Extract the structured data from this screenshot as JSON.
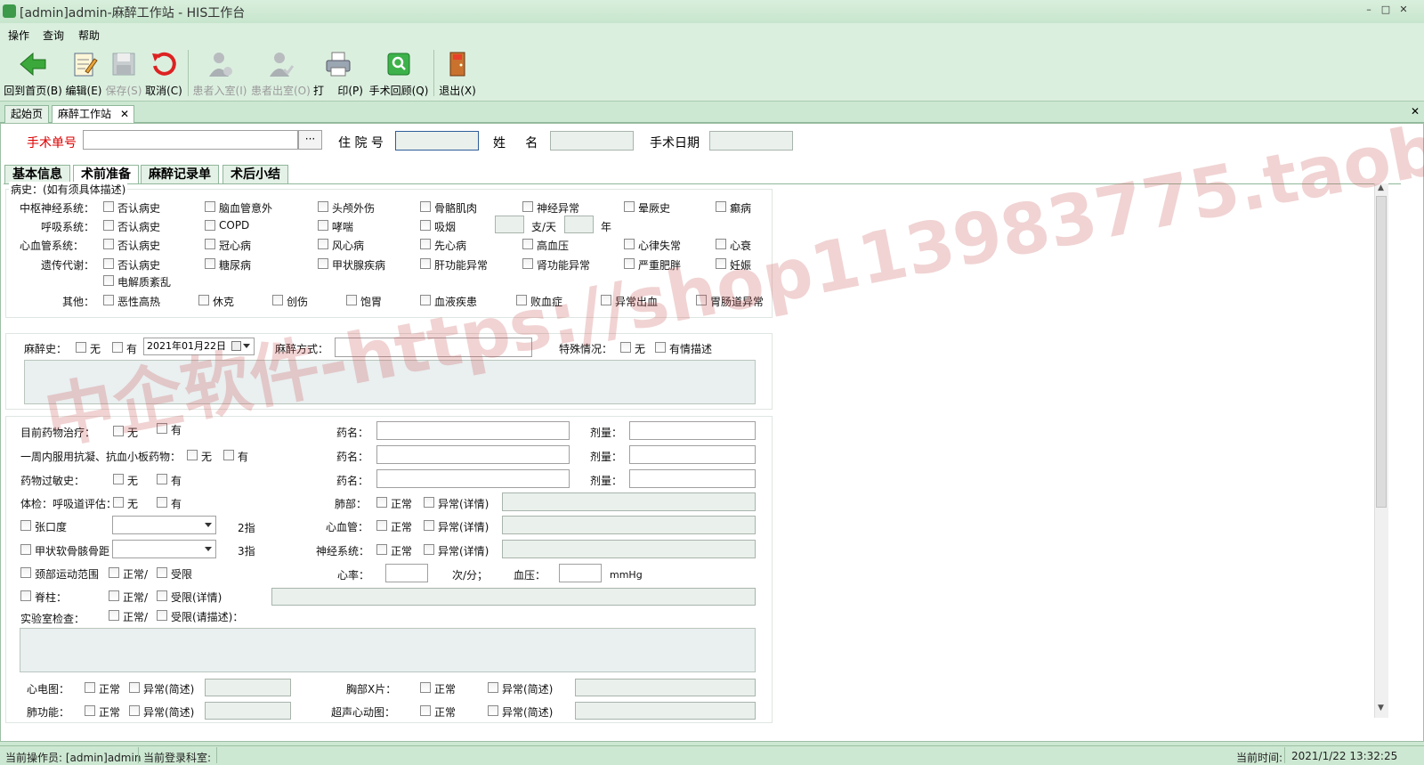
{
  "window": {
    "title": "[admin]admin-麻醉工作站 - HIS工作台",
    "min": "–",
    "max": "□",
    "close": "✕"
  },
  "menu": [
    "操作",
    "查询",
    "帮助"
  ],
  "toolbar": [
    {
      "label": "回到首页(B)",
      "icon": "home-back-icon",
      "enabled": true
    },
    {
      "label": "编辑(E)",
      "icon": "edit-icon",
      "enabled": true
    },
    {
      "label": "保存(S)",
      "icon": "save-icon",
      "enabled": false
    },
    {
      "label": "取消(C)",
      "icon": "cancel-icon",
      "enabled": true
    },
    {
      "label": "患者入室(I)",
      "icon": "patient-in-icon",
      "enabled": false
    },
    {
      "label": "患者出室(O)",
      "icon": "patient-out-icon",
      "enabled": false
    },
    {
      "label": "打",
      "icon": "print-icon",
      "enabled": true
    },
    {
      "label": "印(P)",
      "icon": "print-label",
      "enabled": true
    },
    {
      "label": "手术回顾(Q)",
      "icon": "search-icon",
      "enabled": true
    },
    {
      "label": "退出(X)",
      "icon": "exit-icon",
      "enabled": true
    }
  ],
  "doc_tabs": [
    {
      "label": "起始页"
    },
    {
      "label": "麻醉工作站",
      "close": "✕"
    }
  ],
  "panel_close": "✕",
  "header": {
    "surgery_no_label": "手术单号",
    "surgery_no_value": "",
    "browse": "···",
    "admission_label": "住 院 号",
    "name_label": "姓     名",
    "date_label": "手术日期"
  },
  "form_tabs": [
    "基本信息",
    "术前准备",
    "麻醉记录单",
    "术后小结"
  ],
  "history": {
    "title": "病史：(如有须具体描述)",
    "rows": [
      {
        "label": "中枢神经系统：",
        "items": [
          "否认病史",
          "脑血管意外",
          "头颅外伤",
          "骨骼肌肉",
          "神经异常",
          "晕厥史",
          "癫病"
        ]
      },
      {
        "label": "呼吸系统：",
        "items": [
          "否认病史",
          "COPD",
          "哮喘",
          "吸烟"
        ],
        "smoke_unit": "支/天",
        "year_unit": "年"
      },
      {
        "label": "心血管系统：",
        "items": [
          "否认病史",
          "冠心病",
          "风心病",
          "先心病",
          "高血压",
          "心律失常",
          "心衰"
        ]
      },
      {
        "label": "遗传代谢：",
        "items": [
          "否认病史",
          "糖尿病",
          "甲状腺疾病",
          "肝功能异常",
          "肾功能异常",
          "严重肥胖",
          "妊娠",
          "电解质紊乱"
        ]
      },
      {
        "label": "其他：",
        "items": [
          "恶性高热",
          "休克",
          "创伤",
          "饱胃",
          "血液疾患",
          "败血症",
          "异常出血",
          "胃肠道异常"
        ]
      }
    ]
  },
  "anes_history": {
    "label": "麻醉史：",
    "none": "无",
    "has": "有",
    "date": "2021年01月22日",
    "method_label": "麻醉方式：",
    "special_label": "特殊情况：",
    "special_none": "无",
    "special_desc": "有情描述"
  },
  "exam": {
    "current_med": "目前药物治疗：",
    "anticoag": "一周内服用抗凝、抗血小板药物：",
    "allergy": "药物过敏史：",
    "airway": "体检：呼吸道评估：",
    "none": "无",
    "has": "有",
    "drug_name": "药名：",
    "dose": "剂量：",
    "lung": "肺部：",
    "heart": "心血管：",
    "neuro": "神经系统：",
    "normal": "正常",
    "abnormal_detail": "异常(详情)",
    "mouth": "张口度",
    "thyroid": "甲状软骨骸骨距",
    "finger2": "2指",
    "finger3": "3指",
    "neck": "颈部运动范围",
    "spine": "脊柱：",
    "lab": "实验室检查：",
    "normal_slash": "正常/",
    "limited": "受限",
    "limited_detail": "受限(详情)",
    "limited_desc": "受限(请描述)：",
    "hr": "心率：",
    "hr_unit": "次/分；",
    "bp": "血压：",
    "bp_unit": "mmHg",
    "ecg": "心电图：",
    "chest": "胸部X片：",
    "lungfn": "肺功能：",
    "echo": "超声心动图：",
    "abnormal_brief": "异常(简述)"
  },
  "watermark": "中企软件-https://shop113983775.taobao.com",
  "status": {
    "operator": "当前操作员: [admin]admin",
    "dept": "当前登录科室:",
    "time_label": "当前时间:",
    "time": "2021/1/22 13:32:25"
  }
}
